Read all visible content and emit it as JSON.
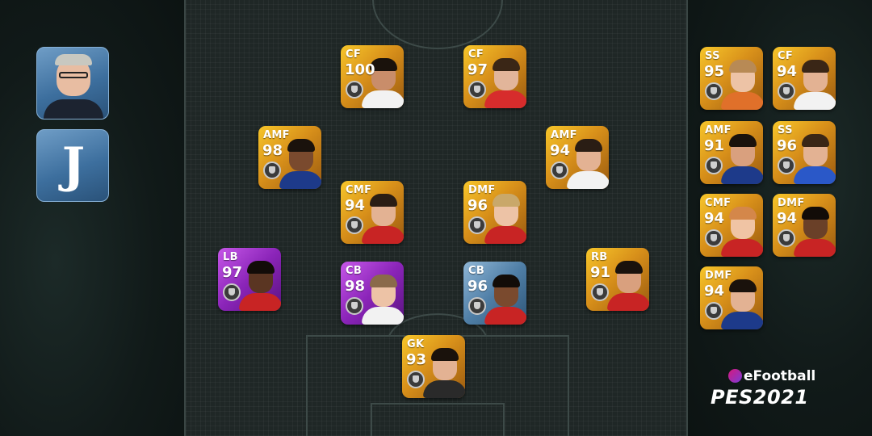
{
  "manager": {
    "icon": "manager-photo",
    "label": ""
  },
  "team": {
    "icon": "juventus-crest",
    "crest_text": "J"
  },
  "logo": {
    "brand": "eFootball",
    "game": "PES2021"
  },
  "colors": {
    "gold": "#d8901a",
    "purple": "#8a24b8",
    "silver": "#4f7ea6",
    "pitch": "#1f2726"
  },
  "lineup": [
    {
      "pos": "CF",
      "rating": "100",
      "tier": "gold",
      "skin": "#c98d6a",
      "hair": "#1a120c",
      "shirt": "#f2f2f2"
    },
    {
      "pos": "CF",
      "rating": "97",
      "tier": "gold",
      "skin": "#e2b59a",
      "hair": "#3a2616",
      "shirt": "#d72c2c"
    },
    {
      "pos": "AMF",
      "rating": "98",
      "tier": "gold",
      "skin": "#7a4a2e",
      "hair": "#1a120c",
      "shirt": "#1d3a8a"
    },
    {
      "pos": "AMF",
      "rating": "94",
      "tier": "gold",
      "skin": "#e3b293",
      "hair": "#2a1d14",
      "shirt": "#f2f2f2"
    },
    {
      "pos": "CMF",
      "rating": "94",
      "tier": "gold",
      "skin": "#e3b293",
      "hair": "#2a1d14",
      "shirt": "#c82424"
    },
    {
      "pos": "DMF",
      "rating": "96",
      "tier": "gold",
      "skin": "#edc3a6",
      "hair": "#c9a86a",
      "shirt": "#c82424"
    },
    {
      "pos": "LB",
      "rating": "97",
      "tier": "purple",
      "skin": "#5a3522",
      "hair": "#120c08",
      "shirt": "#c82424"
    },
    {
      "pos": "CB",
      "rating": "98",
      "tier": "purple",
      "skin": "#edc3a6",
      "hair": "#8a6a4a",
      "shirt": "#f2f2f2"
    },
    {
      "pos": "CB",
      "rating": "96",
      "tier": "silver",
      "skin": "#7a4a2e",
      "hair": "#120c08",
      "shirt": "#c82424"
    },
    {
      "pos": "RB",
      "rating": "91",
      "tier": "gold",
      "skin": "#d9a07e",
      "hair": "#1a120c",
      "shirt": "#c82424"
    },
    {
      "pos": "GK",
      "rating": "93",
      "tier": "gold",
      "skin": "#e3b293",
      "hair": "#1a120c",
      "shirt": "#2a2a2a"
    }
  ],
  "subs": [
    {
      "pos": "SS",
      "rating": "95",
      "tier": "gold",
      "skin": "#edc3a6",
      "hair": "#b88a55",
      "shirt": "#e0702a"
    },
    {
      "pos": "CF",
      "rating": "94",
      "tier": "gold",
      "skin": "#e3b293",
      "hair": "#3a2616",
      "shirt": "#f2f2f2"
    },
    {
      "pos": "AMF",
      "rating": "91",
      "tier": "gold",
      "skin": "#d9a07e",
      "hair": "#1a120c",
      "shirt": "#1d3a8a"
    },
    {
      "pos": "SS",
      "rating": "96",
      "tier": "gold",
      "skin": "#e3b293",
      "hair": "#3a2616",
      "shirt": "#2a58c8"
    },
    {
      "pos": "CMF",
      "rating": "94",
      "tier": "gold",
      "skin": "#f0c4a4",
      "hair": "#d4874a",
      "shirt": "#c82424"
    },
    {
      "pos": "DMF",
      "rating": "94",
      "tier": "gold",
      "skin": "#6a4028",
      "hair": "#120c08",
      "shirt": "#c82424"
    },
    {
      "pos": "DMF",
      "rating": "94",
      "tier": "gold",
      "skin": "#e3b293",
      "hair": "#1a120c",
      "shirt": "#1d3a8a"
    }
  ]
}
